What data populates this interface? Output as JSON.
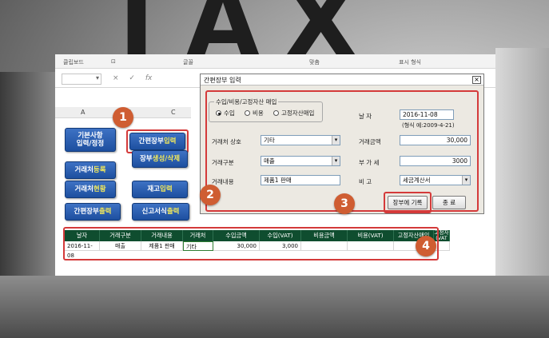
{
  "background_text": "TAX",
  "ribbon": {
    "clipboard": "클립보드",
    "font": "글꼴",
    "align": "맞춤",
    "number": "표시 형식"
  },
  "formula": {
    "fx": "fx",
    "cancel": "×",
    "enter": "✓"
  },
  "columns": [
    "A",
    "B",
    "C"
  ],
  "menu": {
    "basic": "기본사항\n입력/정정",
    "ledger_input_a": "간편장부 ",
    "ledger_input_b": "입력",
    "ledger_create_a": "장부 ",
    "ledger_create_b": "생성/삭제",
    "partner_reg_a": "거래처 ",
    "partner_reg_b": "등록",
    "partner_status_a": "거래처 ",
    "partner_status_b": "현황",
    "stock_a": "재고 ",
    "stock_b": "입력",
    "ledger_print_a": "간편장부 ",
    "ledger_print_b": "출력",
    "report_a": "신고서식 ",
    "report_b": "출력"
  },
  "callouts": [
    "1",
    "2",
    "3",
    "4"
  ],
  "dialog": {
    "title": "간편장부 입력",
    "close": "×",
    "group_label": "수입/비용/고정자산 매입",
    "radio": {
      "income": "수입",
      "expense": "비용",
      "asset": "고정자산매입",
      "selected": "income"
    },
    "date_label": "날    자",
    "date_value": "2016-11-08",
    "date_hint": "(형식 예:2009-4-21)",
    "partner_label": "거래처 상호",
    "partner_value": "기타",
    "amount_label": "거래금액",
    "amount_value": "30,000",
    "type_label": "거래구분",
    "type_value": "매출",
    "vat_label": "부 가 세",
    "vat_value": "3000",
    "content_label": "거래내용",
    "content_value": "제품1 판매",
    "note_label": "비    고",
    "note_value": "세금계산서",
    "save_button": "장부에 기록",
    "close_button": "종  료"
  },
  "table": {
    "headers": [
      "날자",
      "거래구분",
      "거래내용",
      "거래처",
      "수입금액",
      "수입(VAT)",
      "비용금액",
      "비용(VAT)",
      "고정자산매입",
      "고정자\n(VAT"
    ],
    "rows": [
      [
        "2016-11-08",
        "매출",
        "제품1 판매",
        "기타",
        "30,000",
        "3,000",
        "",
        "",
        "",
        ""
      ]
    ]
  },
  "colors": {
    "menu_blue": "#1d4f9f",
    "header_green": "#0f4d2f",
    "callout": "#cf5d32",
    "highlight": "#d43a3a"
  }
}
